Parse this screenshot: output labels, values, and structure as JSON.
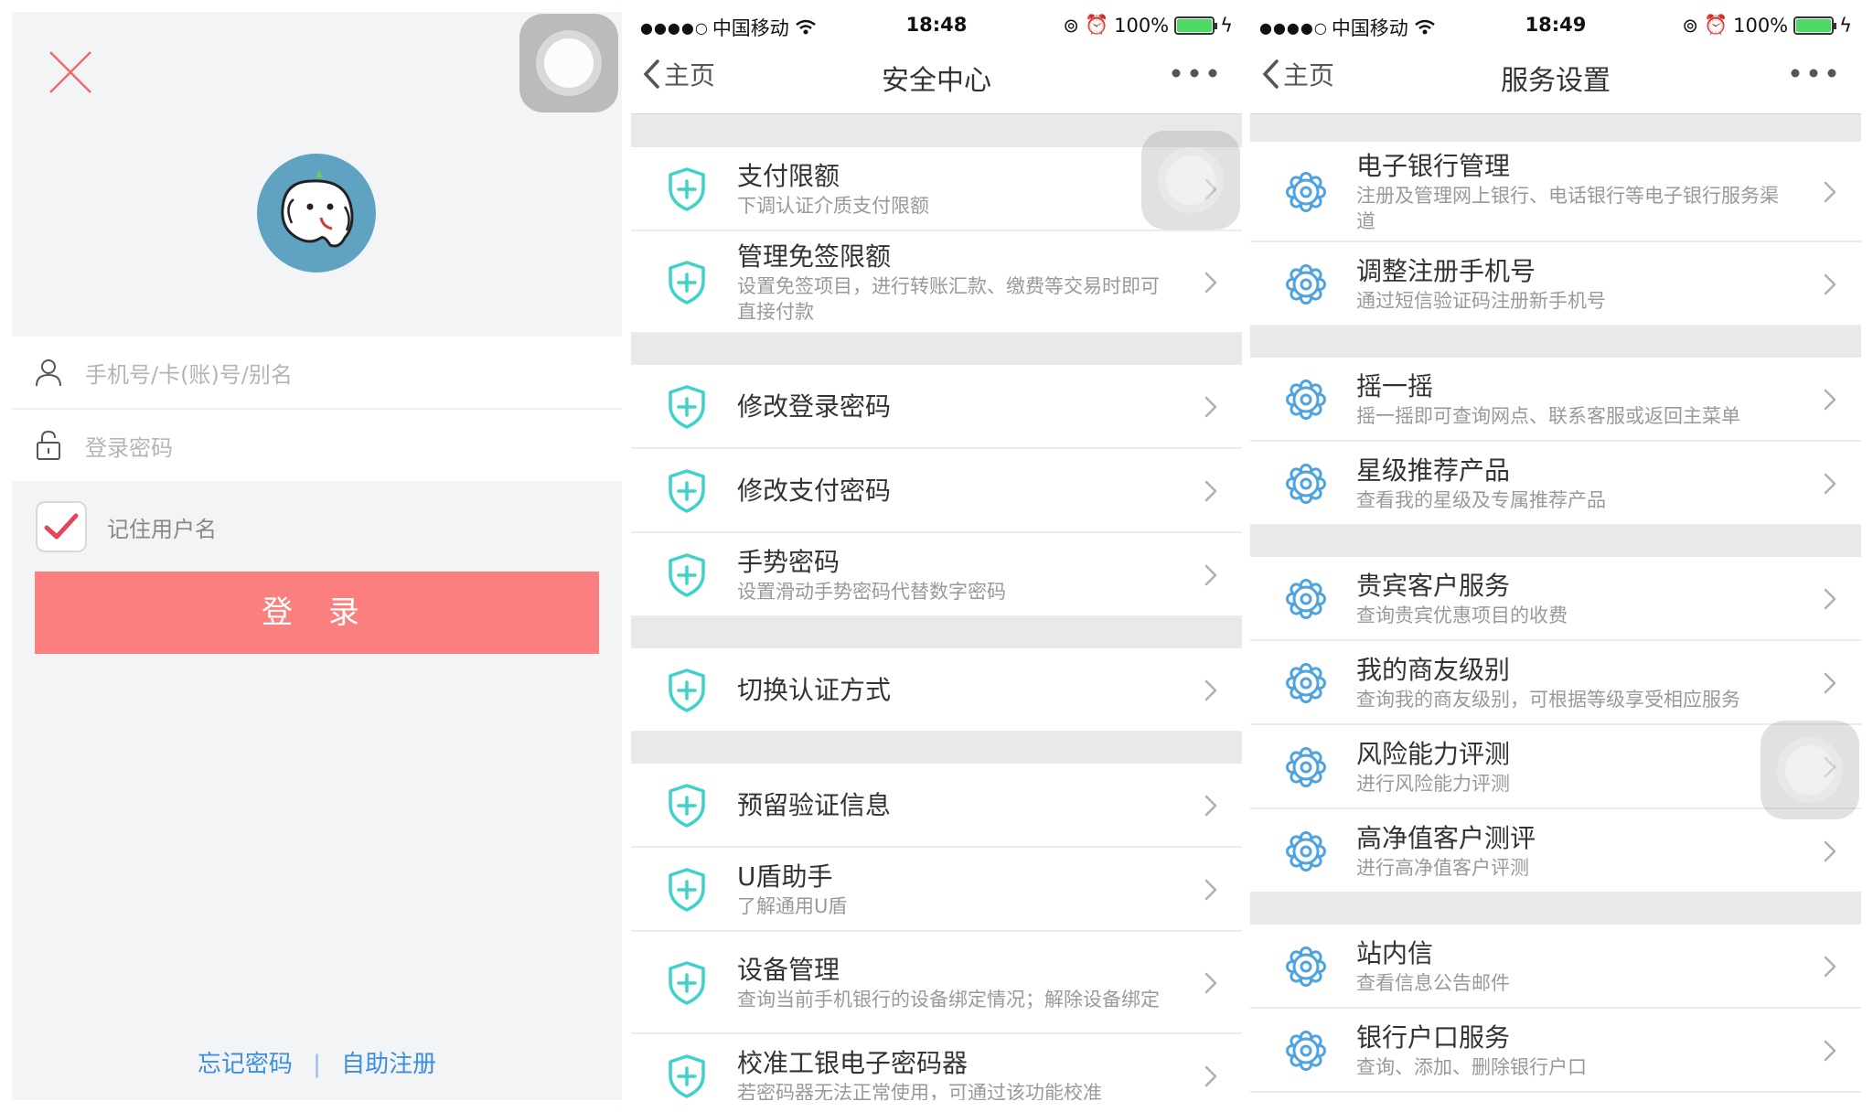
{
  "colors": {
    "accent_blue": "#3c8ee0",
    "login_button": "#fb7f7f",
    "shield_icon": "#3fd2c9",
    "gear_icon": "#4fa3e0",
    "check_mark": "#e4455a",
    "battery": "#4cd964"
  },
  "login": {
    "username_placeholder": "手机号/卡(账)号/别名",
    "password_placeholder": "登录密码",
    "remember_label": "记住用户名",
    "login_button": "登 录",
    "forgot_password": "忘记密码",
    "link_separator": "|",
    "self_register": "自助注册",
    "icons": [
      "close-icon",
      "user-icon",
      "lock-icon",
      "check-icon",
      "assistive-touch-icon"
    ]
  },
  "security_center": {
    "status": {
      "carrier": "中国移动",
      "time": "18:48",
      "battery": "100%"
    },
    "nav": {
      "back": "主页",
      "title": "安全中心"
    },
    "groups": [
      [
        {
          "title": "支付限额",
          "subtitle": "下调认证介质支付限额"
        },
        {
          "title": "管理免签限额",
          "subtitle": "设置免签项目，进行转账汇款、缴费等交易时即可直接付款"
        }
      ],
      [
        {
          "title": "修改登录密码",
          "subtitle": ""
        },
        {
          "title": "修改支付密码",
          "subtitle": ""
        },
        {
          "title": "手势密码",
          "subtitle": "设置滑动手势密码代替数字密码"
        }
      ],
      [
        {
          "title": "切换认证方式",
          "subtitle": ""
        }
      ],
      [
        {
          "title": "预留验证信息",
          "subtitle": ""
        },
        {
          "title": "U盾助手",
          "subtitle": "了解通用U盾"
        },
        {
          "title": "设备管理",
          "subtitle": "查询当前手机银行的设备绑定情况；解除设备绑定"
        },
        {
          "title": "校准工银电子密码器",
          "subtitle": "若密码器无法正常使用，可通过该功能校准"
        }
      ]
    ]
  },
  "service_settings": {
    "status": {
      "carrier": "中国移动",
      "time": "18:49",
      "battery": "100%"
    },
    "nav": {
      "back": "主页",
      "title": "服务设置"
    },
    "groups": [
      [
        {
          "title": "电子银行管理",
          "subtitle": "注册及管理网上银行、电话银行等电子银行服务渠道"
        },
        {
          "title": "调整注册手机号",
          "subtitle": "通过短信验证码注册新手机号"
        }
      ],
      [
        {
          "title": "摇一摇",
          "subtitle": "摇一摇即可查询网点、联系客服或返回主菜单"
        },
        {
          "title": "星级推荐产品",
          "subtitle": "查看我的星级及专属推荐产品"
        }
      ],
      [
        {
          "title": "贵宾客户服务",
          "subtitle": "查询贵宾优惠项目的收费"
        },
        {
          "title": "我的商友级别",
          "subtitle": "查询我的商友级别，可根据等级享受相应服务"
        },
        {
          "title": "风险能力评测",
          "subtitle": "进行风险能力评测"
        },
        {
          "title": "高净值客户测评",
          "subtitle": "进行高净值客户评测"
        }
      ],
      [
        {
          "title": "站内信",
          "subtitle": "查看信息公告邮件"
        },
        {
          "title": "银行户口服务",
          "subtitle": "查询、添加、删除银行户口"
        }
      ]
    ]
  }
}
